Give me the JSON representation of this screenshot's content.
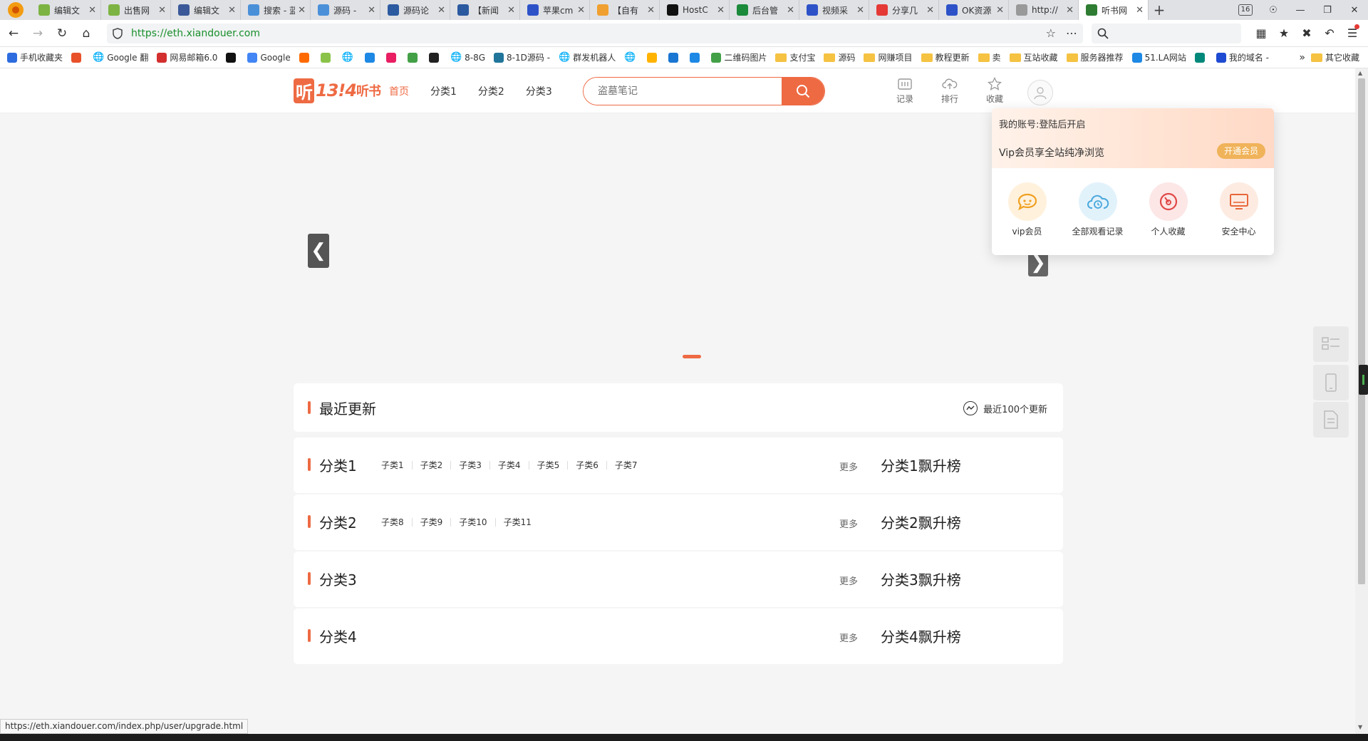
{
  "browser": {
    "tabs": [
      {
        "label": "编辑文",
        "color": "#7cb342"
      },
      {
        "label": "出售网",
        "color": "#7cb342"
      },
      {
        "label": "编辑文",
        "color": "#3b5998"
      },
      {
        "label": "搜索 - 蓝",
        "color": "#4a90d9"
      },
      {
        "label": "源码 -",
        "color": "#4a90d9"
      },
      {
        "label": "源码论",
        "color": "#2c5aa0"
      },
      {
        "label": "【新闻",
        "color": "#2c5aa0"
      },
      {
        "label": "苹果cm",
        "color": "#2d52c8"
      },
      {
        "label": "【自有",
        "color": "#f0a030"
      },
      {
        "label": "HostC",
        "color": "#111111"
      },
      {
        "label": "后台管",
        "color": "#1b8a3a"
      },
      {
        "label": "视频采",
        "color": "#2d52c8"
      },
      {
        "label": "分享几",
        "color": "#e53935"
      },
      {
        "label": "OK资源",
        "color": "#2d52c8"
      },
      {
        "label": "http://",
        "color": "#999999"
      },
      {
        "label": "听书网",
        "color": "#2e7d32"
      }
    ],
    "active_tab_index": 15,
    "tab_count": "16",
    "url": "https://eth.xiandouer.com",
    "bookmarks": [
      {
        "label": "手机收藏夹",
        "type": "icon",
        "color": "#2d6cdf"
      },
      {
        "label": "",
        "type": "icon",
        "color": "#e8512a"
      },
      {
        "label": "Google 翻",
        "type": "globe"
      },
      {
        "label": "网易邮箱6.0",
        "type": "icon",
        "color": "#d32f2f"
      },
      {
        "label": "",
        "type": "icon",
        "color": "#111111"
      },
      {
        "label": "Google",
        "type": "icon",
        "color": "#4285f4"
      },
      {
        "label": "",
        "type": "icon",
        "color": "#ff6a00"
      },
      {
        "label": "",
        "type": "icon",
        "color": "#8bc34a"
      },
      {
        "label": "",
        "type": "globe"
      },
      {
        "label": "",
        "type": "icon",
        "color": "#1e88e5"
      },
      {
        "label": "",
        "type": "icon",
        "color": "#e91e63"
      },
      {
        "label": "",
        "type": "icon",
        "color": "#43a047"
      },
      {
        "label": "",
        "type": "icon",
        "color": "#222222"
      },
      {
        "label": "8-8G",
        "type": "globe"
      },
      {
        "label": "8-1D源码 -",
        "type": "icon",
        "color": "#21759b"
      },
      {
        "label": "群发机器人",
        "type": "globe"
      },
      {
        "label": "",
        "type": "globe"
      },
      {
        "label": "",
        "type": "icon",
        "color": "#ffb300"
      },
      {
        "label": "",
        "type": "icon",
        "color": "#1976d2"
      },
      {
        "label": "",
        "type": "icon",
        "color": "#1e88e5"
      },
      {
        "label": "二维码图片",
        "type": "icon",
        "color": "#43a047"
      },
      {
        "label": "支付宝",
        "type": "folder"
      },
      {
        "label": "源码",
        "type": "folder"
      },
      {
        "label": "网赚项目",
        "type": "folder"
      },
      {
        "label": "教程更新",
        "type": "folder"
      },
      {
        "label": "卖",
        "type": "folder"
      },
      {
        "label": "互站收藏",
        "type": "folder"
      },
      {
        "label": "服务器推荐",
        "type": "folder"
      },
      {
        "label": "51.LA网站",
        "type": "icon",
        "color": "#1e88e5"
      },
      {
        "label": "",
        "type": "icon",
        "color": "#00897b"
      },
      {
        "label": "我的域名 -",
        "type": "icon",
        "color": "#1e4bd2"
      }
    ],
    "bookmarks_overflow": "»",
    "other_bookmarks": "其它收藏",
    "status_url": "https://eth.xiandouer.com/index.php/user/upgrade.html"
  },
  "site": {
    "logo_text": "听书网",
    "nav": [
      {
        "label": "首页",
        "active": true
      },
      {
        "label": "分类1",
        "active": false
      },
      {
        "label": "分类2",
        "active": false
      },
      {
        "label": "分类3",
        "active": false
      }
    ],
    "search_placeholder": "盗墓笔记",
    "header_icons": {
      "history": "记录",
      "rank": "排行",
      "favorite": "收藏"
    },
    "recent": {
      "title": "最近更新",
      "link": "最近100个更新"
    },
    "categories": [
      {
        "title": "分类1",
        "subs": [
          "子类1",
          "子类2",
          "子类3",
          "子类4",
          "子类5",
          "子类6",
          "子类7"
        ],
        "more": "更多",
        "rank": "分类1飘升榜"
      },
      {
        "title": "分类2",
        "subs": [
          "子类8",
          "子类9",
          "子类10",
          "子类11"
        ],
        "more": "更多",
        "rank": "分类2飘升榜"
      },
      {
        "title": "分类3",
        "subs": [],
        "more": "更多",
        "rank": "分类3飘升榜"
      },
      {
        "title": "分类4",
        "subs": [],
        "more": "更多",
        "rank": "分类4飘升榜"
      }
    ],
    "user_menu": {
      "account": "我的账号:登陆后开启",
      "vip_text": "Vip会员享全站纯净浏览",
      "open_vip": "开通会员",
      "items": [
        "vip会员",
        "全部观看记录",
        "个人收藏",
        "安全中心"
      ]
    }
  },
  "colors": {
    "accent": "#ee6a43",
    "vip_gold": "#f0b35a",
    "url_green": "#1a8f2c"
  }
}
